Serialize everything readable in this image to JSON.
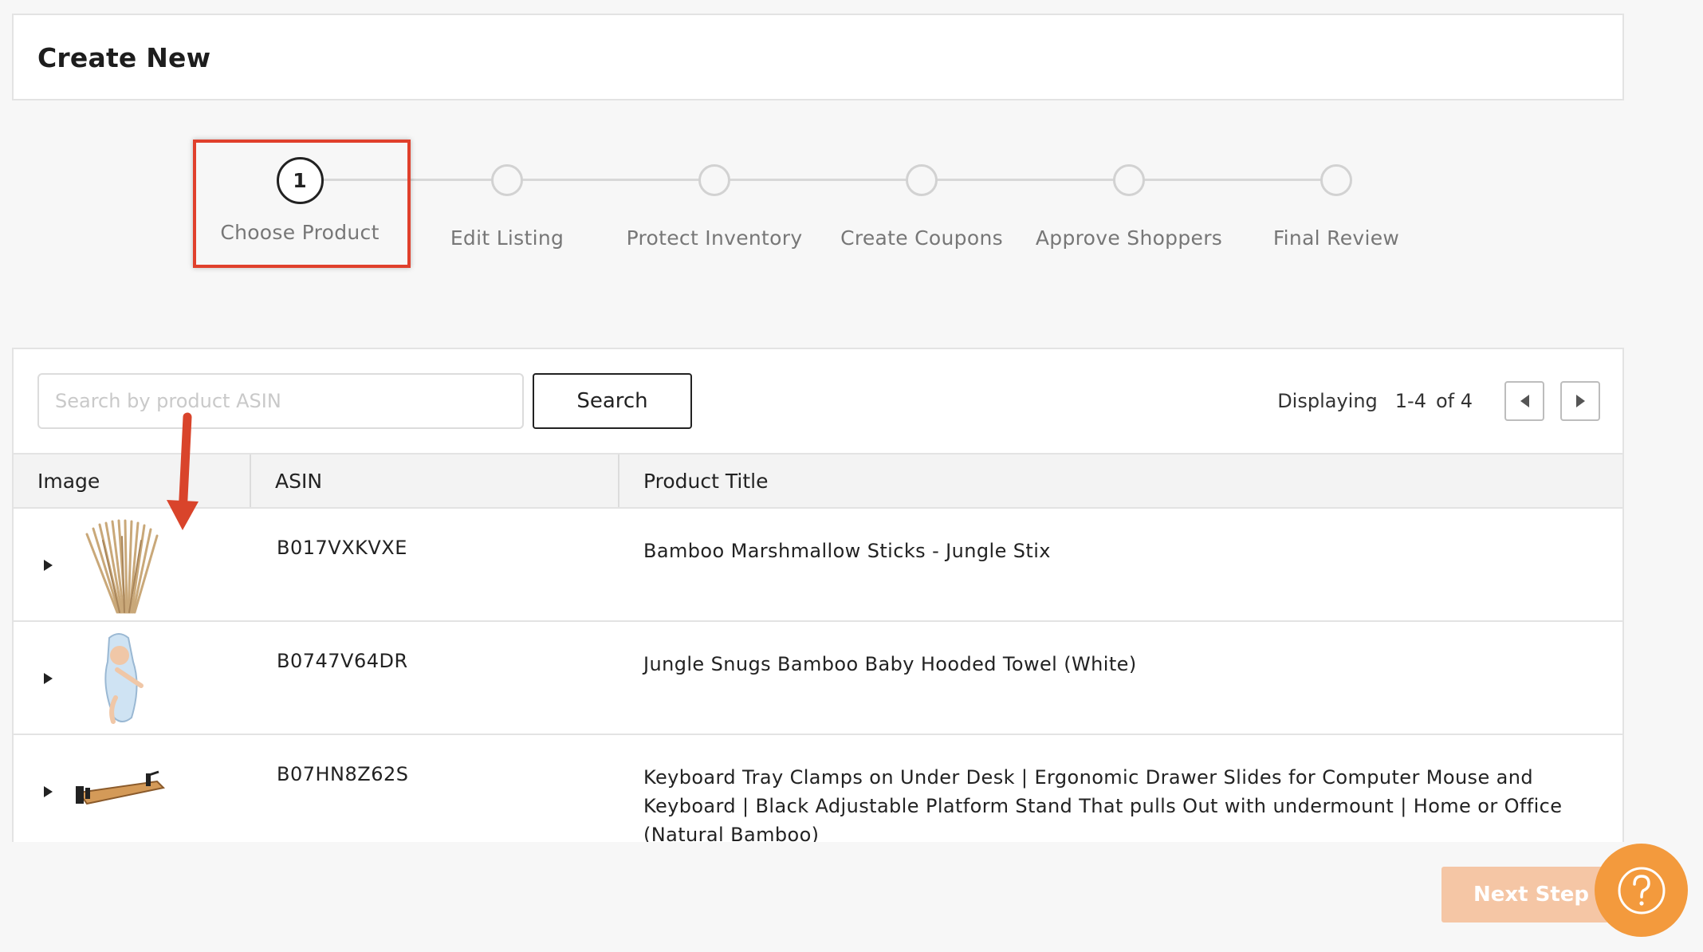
{
  "header": {
    "title": "Create New"
  },
  "stepper": {
    "active_step_number": "1",
    "steps": [
      {
        "label": "Choose Product",
        "active": true
      },
      {
        "label": "Edit Listing",
        "active": false
      },
      {
        "label": "Protect Inventory",
        "active": false
      },
      {
        "label": "Create Coupons",
        "active": false
      },
      {
        "label": "Approve Shoppers",
        "active": false
      },
      {
        "label": "Final Review",
        "active": false
      }
    ]
  },
  "search": {
    "placeholder": "Search by product ASIN",
    "value": "",
    "button_label": "Search"
  },
  "pagination": {
    "displaying_label": "Displaying",
    "range": "1-4",
    "of_label": "of 4"
  },
  "table": {
    "columns": [
      "Image",
      "ASIN",
      "Product Title"
    ],
    "rows": [
      {
        "image_icon": "bamboo-sticks-image",
        "asin": "B017VXKVXE",
        "title": "Bamboo Marshmallow Sticks - Jungle Stix"
      },
      {
        "image_icon": "baby-towel-image",
        "asin": "B0747V64DR",
        "title": "Jungle Snugs Bamboo Baby Hooded Towel (White)"
      },
      {
        "image_icon": "keyboard-tray-image",
        "asin": "B07HN8Z62S",
        "title": "Keyboard Tray Clamps on Under Desk | Ergonomic Drawer Slides for Computer Mouse and Keyboard | Black Adjustable Platform Stand That pulls Out with undermount | Home or Office (Natural Bamboo)"
      }
    ]
  },
  "footer": {
    "next_label": "Next Step",
    "help_icon": "question-icon"
  },
  "colors": {
    "accent": "#f39a3d",
    "next_button_disabled": "#f5c6a5",
    "annotation_red": "#e0402c"
  }
}
